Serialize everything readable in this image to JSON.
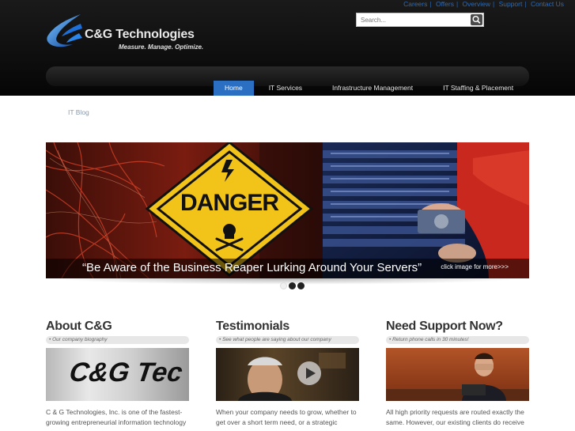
{
  "top_links": [
    "Careers",
    "Offers",
    "Overview",
    "Support",
    "Contact Us"
  ],
  "logo": {
    "name": "C&G Technologies",
    "tagline": "Measure. Manage. Optimize."
  },
  "search": {
    "placeholder": "Search..."
  },
  "nav": {
    "items": [
      "Home",
      "IT Services",
      "Infrastructure Management",
      "IT Staffing & Placement"
    ],
    "active": "Home"
  },
  "blog_link": "IT Blog",
  "slider": {
    "danger_text": "DANGER",
    "caption": "“Be Aware of the Business Reaper Lurking Around Your Servers”",
    "link": "click image for more>>>",
    "slide_count": 3,
    "active_slide": 2
  },
  "columns": [
    {
      "title": "About C&G",
      "subtitle": "• Our company biography",
      "image_text": "C&G Tec",
      "text": "C & G Technologies, Inc. is one of the fastest-growing entrepreneurial information technology"
    },
    {
      "title": "Testimonials",
      "subtitle": "• See what people are saying about our company",
      "text": "When your company needs to grow, whether to get over a short term need, or a strategic"
    },
    {
      "title": "Need Support Now?",
      "subtitle": "• Return phone calls in 30 minutes!",
      "text": "All high priority requests are routed exactly the same. However, our existing clients do receive"
    }
  ],
  "colors": {
    "accent": "#2b6fc2",
    "header": "#0c0c0c",
    "link": "#2f6bb5"
  }
}
